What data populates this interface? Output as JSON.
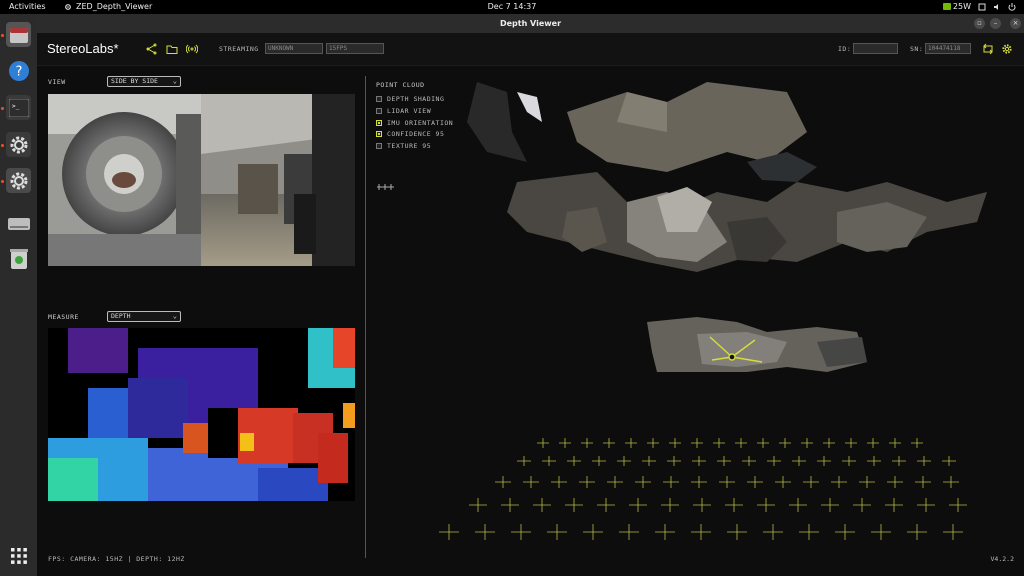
{
  "topbar": {
    "activities": "Activities",
    "app_name": "ZED_Depth_Viewer",
    "clock": "Dec 7  14:37",
    "power": "25W"
  },
  "dock": {
    "items": [
      {
        "name": "files-icon",
        "active": true
      },
      {
        "name": "help-icon",
        "active": false
      },
      {
        "name": "terminal-icon",
        "active": true
      },
      {
        "name": "settings-icon",
        "active": true
      },
      {
        "name": "settings-icon",
        "active": true
      },
      {
        "name": "drive-icon",
        "active": false
      },
      {
        "name": "trash-icon",
        "active": false
      },
      {
        "name": "app-grid-icon",
        "active": false
      }
    ]
  },
  "window": {
    "title": "Depth Viewer"
  },
  "header": {
    "brand": "StereoLabs*",
    "streaming_label": "STREAMING",
    "streaming_value": "UNKNOWN",
    "fps_value": "15FPS",
    "id_label": "ID:",
    "id_value": "",
    "sn_label": "SN:",
    "sn_value": "104474118"
  },
  "left": {
    "view_label": "VIEW",
    "view_option": "SIDE BY SIDE",
    "measure_label": "MEASURE",
    "measure_option": "DEPTH"
  },
  "point_cloud": {
    "title": "POINT CLOUD",
    "options": [
      {
        "label": "DEPTH SHADING",
        "checked": false
      },
      {
        "label": "LIDAR VIEW",
        "checked": false
      },
      {
        "label": "IMU ORIENTATION",
        "checked": true
      },
      {
        "label": "CONFIDENCE 95",
        "checked": true
      },
      {
        "label": "TEXTURE 95",
        "checked": false
      }
    ]
  },
  "footer": {
    "status": "FPS: CAMERA: 15HZ | DEPTH: 12HZ",
    "version": "V4.2.2"
  },
  "colors": {
    "accent": "#d6de3c",
    "ubuntu_orange": "#e95420",
    "nvidia_green": "#76b900"
  }
}
